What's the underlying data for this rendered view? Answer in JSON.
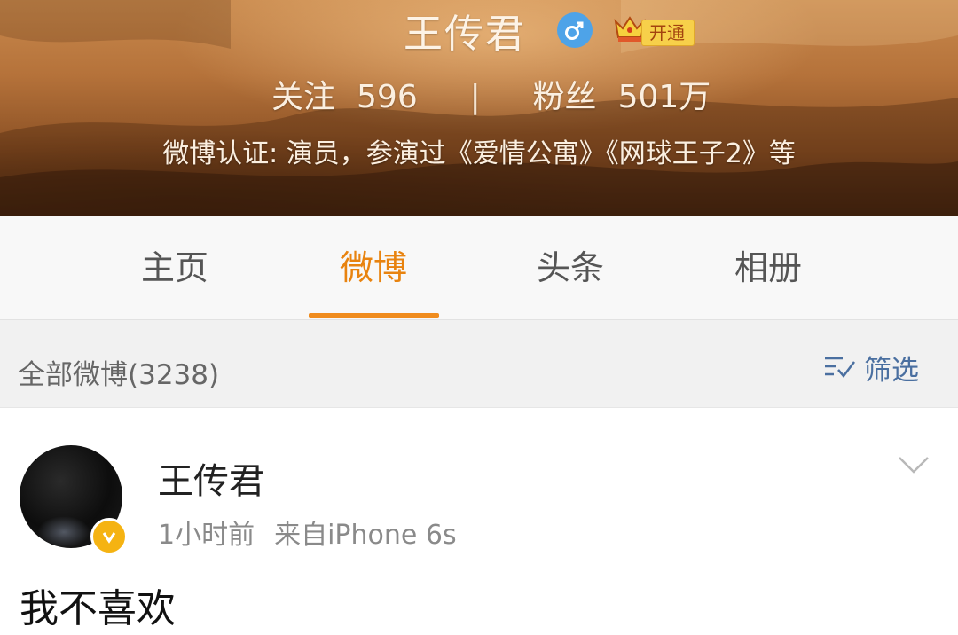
{
  "profile": {
    "name": "王传君",
    "gender_icon": "male-icon",
    "vip_icon": "crown-icon",
    "vip_label": "开通",
    "following_label": "关注",
    "following_count": "596",
    "separator": "|",
    "followers_label": "粉丝",
    "followers_count": "501万",
    "verification": "微博认证: 演员，参演过《爱情公寓》《网球王子2》等"
  },
  "tabs": [
    {
      "label": "主页",
      "active": false
    },
    {
      "label": "微博",
      "active": true
    },
    {
      "label": "头条",
      "active": false
    },
    {
      "label": "相册",
      "active": false
    }
  ],
  "filter": {
    "all_posts": "全部微博(3238)",
    "filter_label": "筛选",
    "filter_icon": "filter-icon"
  },
  "post": {
    "author": "王传君",
    "time": "1小时前",
    "source": "来自iPhone 6s",
    "text": "我不喜欢",
    "menu_icon": "chevron-down-icon",
    "verified_icon": "verified-badge-icon"
  },
  "colors": {
    "accent": "#f08c1e",
    "tab_active": "#e8830f",
    "filter_link": "#4a6fa0",
    "verified": "#f5b312",
    "male": "#4ea3e8"
  }
}
